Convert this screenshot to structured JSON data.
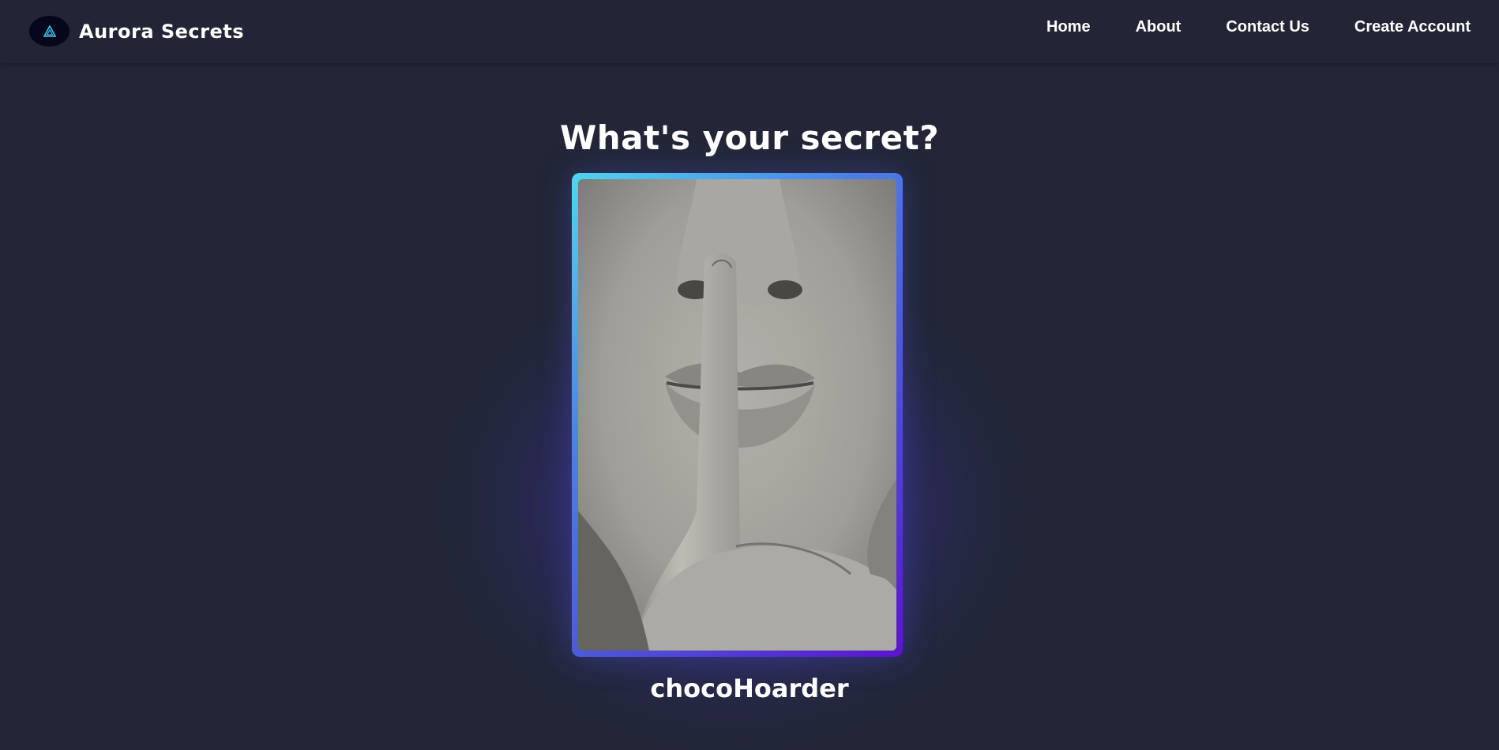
{
  "brand": {
    "name": "Aurora Secrets",
    "logo_icon": "triangle-logo-icon"
  },
  "nav": {
    "items": [
      {
        "label": "Home"
      },
      {
        "label": "About"
      },
      {
        "label": "Contact Us"
      },
      {
        "label": "Create Account"
      }
    ]
  },
  "hero": {
    "title": "What's your secret?",
    "image": "woman-shushing-photo",
    "username": "chocoHoarder"
  },
  "colors": {
    "background": "#222636",
    "navbar": "#222535",
    "text": "#ffffff",
    "frame_gradient_start": "#4fd6ef",
    "frame_gradient_end": "#5b14cf",
    "logo_accent": "#3ec8e8"
  }
}
